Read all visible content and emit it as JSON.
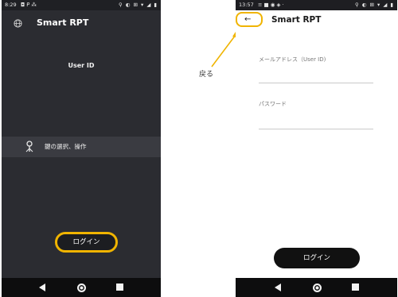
{
  "left_phone": {
    "status_time": "8:29",
    "status_left_icons": "◘ ᑭ ⁂",
    "status_right_icons": "⚲ ◐ ⊞ ▾ ◢ ▮",
    "app_title": "Smart RPT",
    "user_id_label": "User ID",
    "key_menu_label": "鍵の選択、操作",
    "login_button": "ログイン"
  },
  "right_phone": {
    "status_time": "13:57",
    "status_left_icons": "≡ ■ ◉ ◈ ·",
    "status_right_icons": "⚲ ◐ ⊞ ▾ ◢ ▮",
    "back_arrow": "←",
    "app_title": "Smart RPT",
    "email_label": "メールアドレス（User ID)",
    "password_label": "パスワード",
    "login_button": "ログイン"
  },
  "annotation": {
    "back_label": "戻る",
    "highlight_color": "#f0b400"
  },
  "icons": [
    "globe-icon",
    "key-icon",
    "back-arrow-icon",
    "nav-back-icon",
    "nav-home-icon",
    "nav-recent-icon"
  ]
}
